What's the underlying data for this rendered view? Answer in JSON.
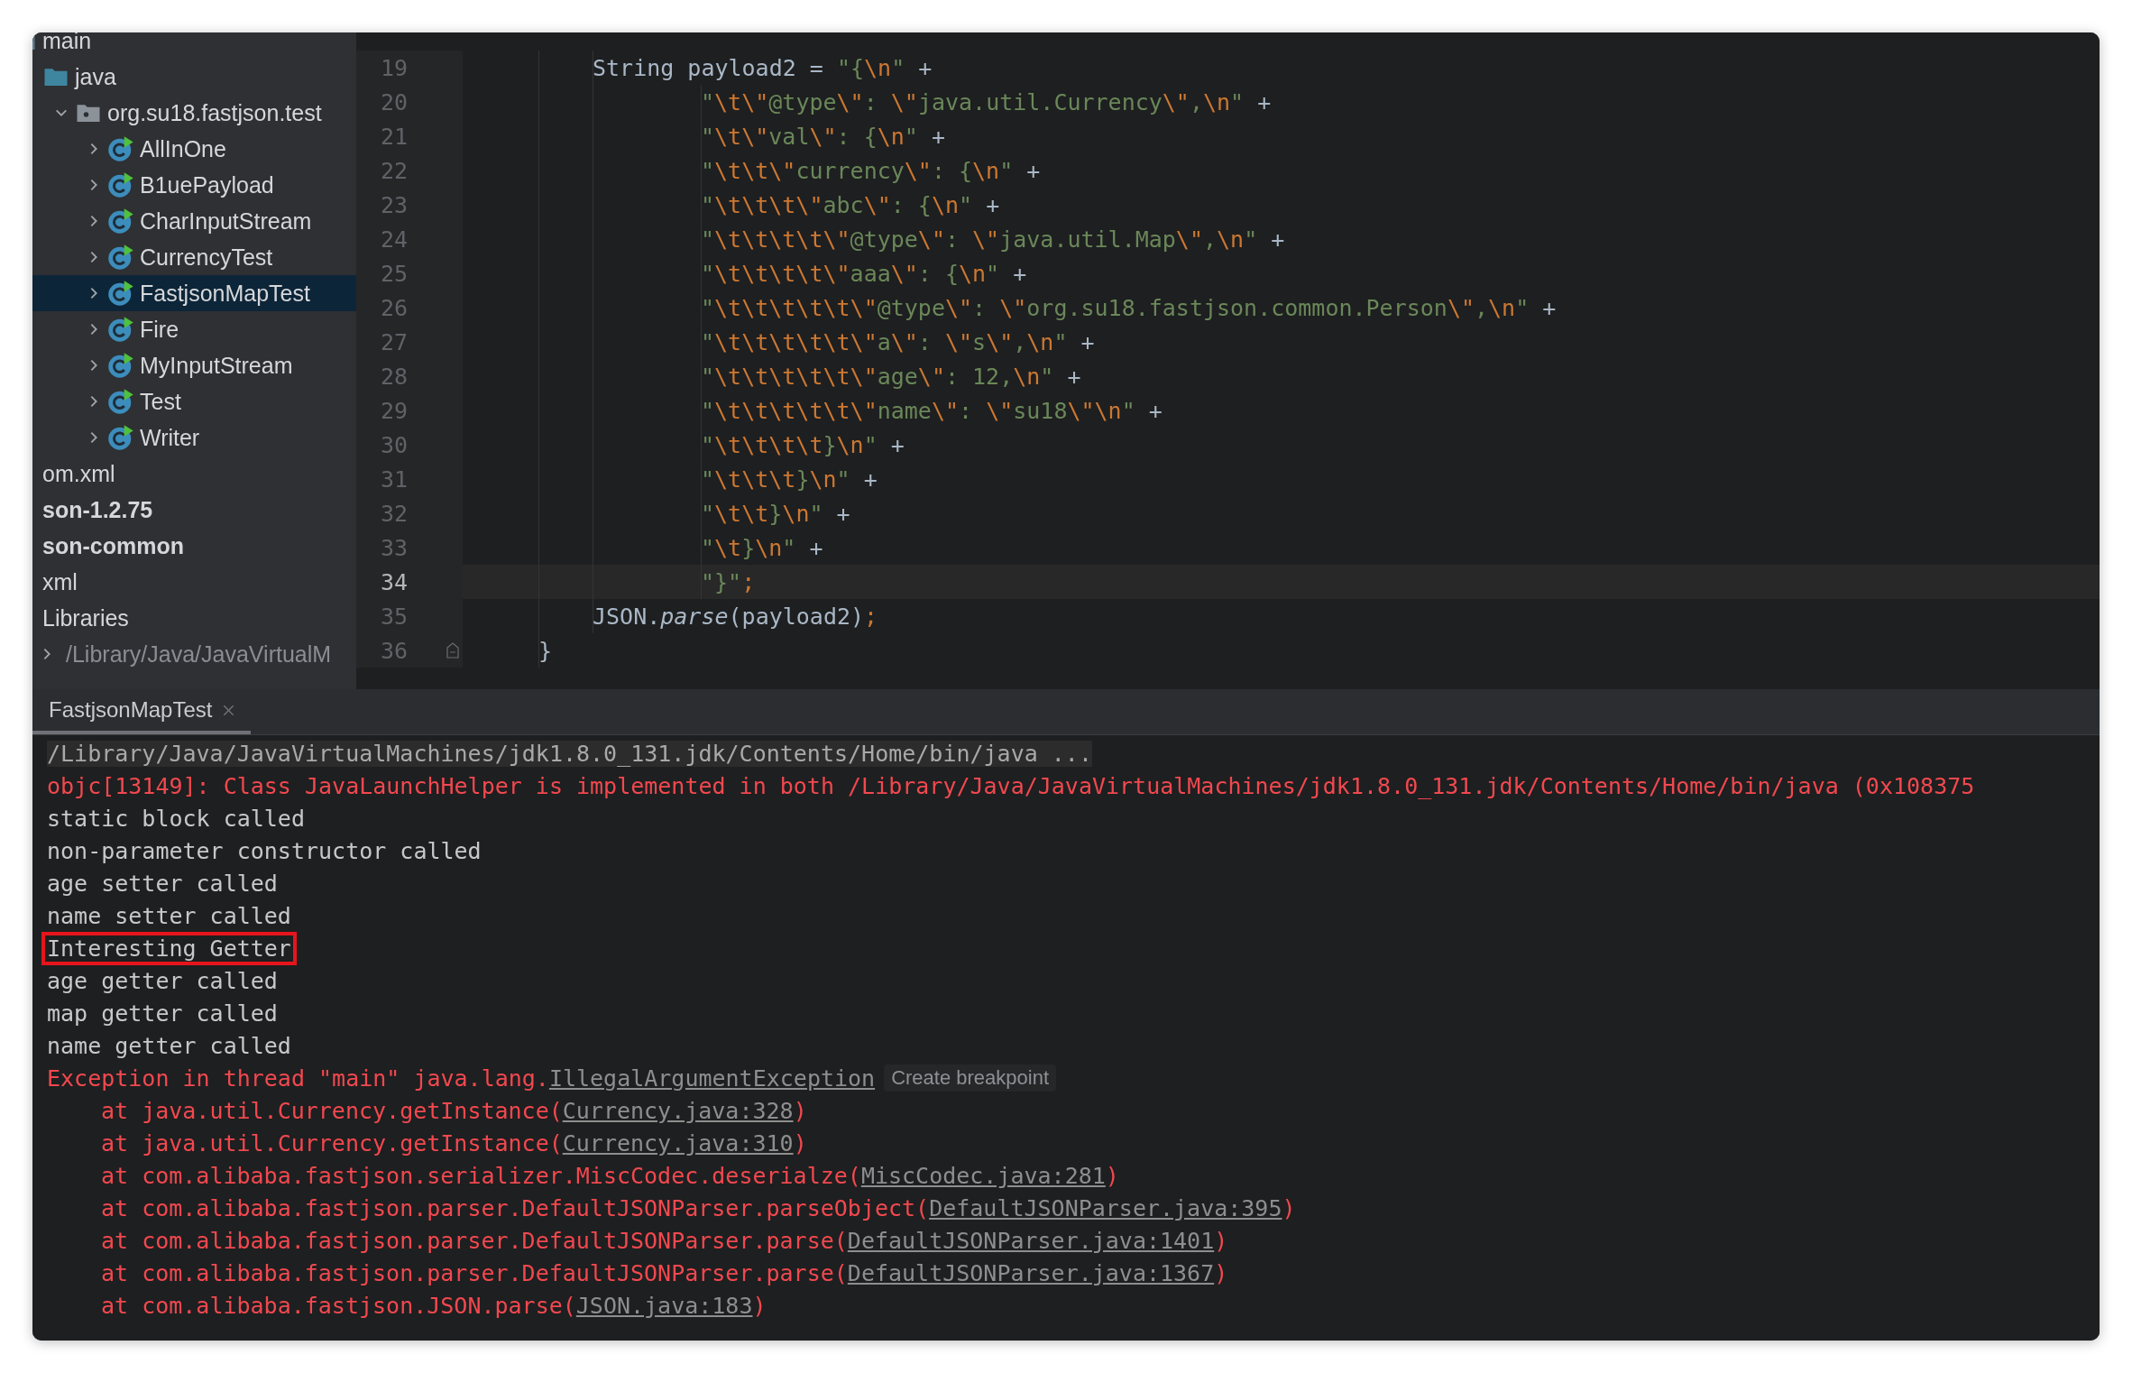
{
  "sidebar": {
    "tree": [
      {
        "label": "main",
        "kind": "folder",
        "selected": false,
        "children": [
          {
            "label": "java",
            "kind": "source-folder",
            "selected": false,
            "children": [
              {
                "label": "org.su18.fastjson.test",
                "kind": "package",
                "expanded": true,
                "selected": false,
                "children": [
                  {
                    "label": "AllInOne",
                    "kind": "class",
                    "expanded": false,
                    "selected": false
                  },
                  {
                    "label": "B1uePayload",
                    "kind": "class",
                    "expanded": false,
                    "selected": false
                  },
                  {
                    "label": "CharInputStream",
                    "kind": "class",
                    "expanded": false,
                    "selected": false
                  },
                  {
                    "label": "CurrencyTest",
                    "kind": "class",
                    "expanded": false,
                    "selected": false
                  },
                  {
                    "label": "FastjsonMapTest",
                    "kind": "class",
                    "expanded": false,
                    "selected": true
                  },
                  {
                    "label": "Fire",
                    "kind": "class",
                    "expanded": false,
                    "selected": false
                  },
                  {
                    "label": "MyInputStream",
                    "kind": "class",
                    "expanded": false,
                    "selected": false
                  },
                  {
                    "label": "Test",
                    "kind": "class",
                    "expanded": false,
                    "selected": false
                  },
                  {
                    "label": "Writer",
                    "kind": "class",
                    "expanded": false,
                    "selected": false
                  }
                ]
              }
            ]
          }
        ]
      },
      {
        "label": "om.xml",
        "kind": "file",
        "selected": false
      },
      {
        "label": "son-1.2.75",
        "kind": "module",
        "selected": false
      },
      {
        "label": "son-common",
        "kind": "module",
        "selected": false
      },
      {
        "label": "xml",
        "kind": "file",
        "selected": false
      },
      {
        "label": "Libraries",
        "kind": "libraries",
        "selected": false,
        "children": [
          {
            "label": "/Library/Java/JavaVirtualM",
            "kind": "sdk",
            "expanded": false,
            "selected": false
          }
        ]
      }
    ]
  },
  "editor": {
    "lines": [
      {
        "number": "19",
        "kind": "statement",
        "current": false,
        "tokens": [
          {
            "kind": "plain",
            "text": "String payload2 = "
          },
          {
            "kind": "str",
            "text": "\"{"
          },
          {
            "kind": "esc",
            "text": "\\n"
          },
          {
            "kind": "str",
            "text": "\""
          },
          {
            "kind": "plain",
            "text": " +"
          }
        ]
      },
      {
        "number": "20",
        "kind": "continuation",
        "current": false,
        "tokens": [
          {
            "kind": "str",
            "text": "\""
          },
          {
            "kind": "esc",
            "text": "\\t\\\""
          },
          {
            "kind": "str",
            "text": "@type"
          },
          {
            "kind": "esc",
            "text": "\\\""
          },
          {
            "kind": "str",
            "text": ": "
          },
          {
            "kind": "esc",
            "text": "\\\""
          },
          {
            "kind": "str",
            "text": "java.util.Currency"
          },
          {
            "kind": "esc",
            "text": "\\\""
          },
          {
            "kind": "str",
            "text": ","
          },
          {
            "kind": "esc",
            "text": "\\n"
          },
          {
            "kind": "str",
            "text": "\""
          },
          {
            "kind": "plain",
            "text": " +"
          }
        ]
      },
      {
        "number": "21",
        "kind": "continuation",
        "current": false,
        "tokens": [
          {
            "kind": "str",
            "text": "\""
          },
          {
            "kind": "esc",
            "text": "\\t\\\""
          },
          {
            "kind": "str",
            "text": "val"
          },
          {
            "kind": "esc",
            "text": "\\\""
          },
          {
            "kind": "str",
            "text": ": {"
          },
          {
            "kind": "esc",
            "text": "\\n"
          },
          {
            "kind": "str",
            "text": "\""
          },
          {
            "kind": "plain",
            "text": " +"
          }
        ]
      },
      {
        "number": "22",
        "kind": "continuation",
        "current": false,
        "tokens": [
          {
            "kind": "str",
            "text": "\""
          },
          {
            "kind": "esc",
            "text": "\\t\\t\\\""
          },
          {
            "kind": "str",
            "text": "currency"
          },
          {
            "kind": "esc",
            "text": "\\\""
          },
          {
            "kind": "str",
            "text": ": {"
          },
          {
            "kind": "esc",
            "text": "\\n"
          },
          {
            "kind": "str",
            "text": "\""
          },
          {
            "kind": "plain",
            "text": " +"
          }
        ]
      },
      {
        "number": "23",
        "kind": "continuation",
        "current": false,
        "tokens": [
          {
            "kind": "str",
            "text": "\""
          },
          {
            "kind": "esc",
            "text": "\\t\\t\\t\\\""
          },
          {
            "kind": "str",
            "text": "abc"
          },
          {
            "kind": "esc",
            "text": "\\\""
          },
          {
            "kind": "str",
            "text": ": {"
          },
          {
            "kind": "esc",
            "text": "\\n"
          },
          {
            "kind": "str",
            "text": "\""
          },
          {
            "kind": "plain",
            "text": " +"
          }
        ]
      },
      {
        "number": "24",
        "kind": "continuation",
        "current": false,
        "tokens": [
          {
            "kind": "str",
            "text": "\""
          },
          {
            "kind": "esc",
            "text": "\\t\\t\\t\\t\\\""
          },
          {
            "kind": "str",
            "text": "@type"
          },
          {
            "kind": "esc",
            "text": "\\\""
          },
          {
            "kind": "str",
            "text": ": "
          },
          {
            "kind": "esc",
            "text": "\\\""
          },
          {
            "kind": "str",
            "text": "java.util.Map"
          },
          {
            "kind": "esc",
            "text": "\\\""
          },
          {
            "kind": "str",
            "text": ","
          },
          {
            "kind": "esc",
            "text": "\\n"
          },
          {
            "kind": "str",
            "text": "\""
          },
          {
            "kind": "plain",
            "text": " +"
          }
        ]
      },
      {
        "number": "25",
        "kind": "continuation",
        "current": false,
        "tokens": [
          {
            "kind": "str",
            "text": "\""
          },
          {
            "kind": "esc",
            "text": "\\t\\t\\t\\t\\\""
          },
          {
            "kind": "str",
            "text": "aaa"
          },
          {
            "kind": "esc",
            "text": "\\\""
          },
          {
            "kind": "str",
            "text": ": {"
          },
          {
            "kind": "esc",
            "text": "\\n"
          },
          {
            "kind": "str",
            "text": "\""
          },
          {
            "kind": "plain",
            "text": " +"
          }
        ]
      },
      {
        "number": "26",
        "kind": "continuation",
        "current": false,
        "tokens": [
          {
            "kind": "str",
            "text": "\""
          },
          {
            "kind": "esc",
            "text": "\\t\\t\\t\\t\\t\\\""
          },
          {
            "kind": "str",
            "text": "@type"
          },
          {
            "kind": "esc",
            "text": "\\\""
          },
          {
            "kind": "str",
            "text": ": "
          },
          {
            "kind": "esc",
            "text": "\\\""
          },
          {
            "kind": "str",
            "text": "org.su18.fastjson.common.Person"
          },
          {
            "kind": "esc",
            "text": "\\\""
          },
          {
            "kind": "str",
            "text": ","
          },
          {
            "kind": "esc",
            "text": "\\n"
          },
          {
            "kind": "str",
            "text": "\""
          },
          {
            "kind": "plain",
            "text": " +"
          }
        ]
      },
      {
        "number": "27",
        "kind": "continuation",
        "current": false,
        "tokens": [
          {
            "kind": "str",
            "text": "\""
          },
          {
            "kind": "esc",
            "text": "\\t\\t\\t\\t\\t\\\""
          },
          {
            "kind": "str",
            "text": "a"
          },
          {
            "kind": "esc",
            "text": "\\\""
          },
          {
            "kind": "str",
            "text": ": "
          },
          {
            "kind": "esc",
            "text": "\\\""
          },
          {
            "kind": "str",
            "text": "s"
          },
          {
            "kind": "esc",
            "text": "\\\""
          },
          {
            "kind": "str",
            "text": ","
          },
          {
            "kind": "esc",
            "text": "\\n"
          },
          {
            "kind": "str",
            "text": "\""
          },
          {
            "kind": "plain",
            "text": " +"
          }
        ]
      },
      {
        "number": "28",
        "kind": "continuation",
        "current": false,
        "tokens": [
          {
            "kind": "str",
            "text": "\""
          },
          {
            "kind": "esc",
            "text": "\\t\\t\\t\\t\\t\\\""
          },
          {
            "kind": "str",
            "text": "age"
          },
          {
            "kind": "esc",
            "text": "\\\""
          },
          {
            "kind": "str",
            "text": ": 12,"
          },
          {
            "kind": "esc",
            "text": "\\n"
          },
          {
            "kind": "str",
            "text": "\""
          },
          {
            "kind": "plain",
            "text": " +"
          }
        ]
      },
      {
        "number": "29",
        "kind": "continuation",
        "current": false,
        "tokens": [
          {
            "kind": "str",
            "text": "\""
          },
          {
            "kind": "esc",
            "text": "\\t\\t\\t\\t\\t\\\""
          },
          {
            "kind": "str",
            "text": "name"
          },
          {
            "kind": "esc",
            "text": "\\\""
          },
          {
            "kind": "str",
            "text": ": "
          },
          {
            "kind": "esc",
            "text": "\\\""
          },
          {
            "kind": "str",
            "text": "su18"
          },
          {
            "kind": "esc",
            "text": "\\\"\\n"
          },
          {
            "kind": "str",
            "text": "\""
          },
          {
            "kind": "plain",
            "text": " +"
          }
        ]
      },
      {
        "number": "30",
        "kind": "continuation",
        "current": false,
        "tokens": [
          {
            "kind": "str",
            "text": "\""
          },
          {
            "kind": "esc",
            "text": "\\t\\t\\t\\t"
          },
          {
            "kind": "str",
            "text": "}"
          },
          {
            "kind": "esc",
            "text": "\\n"
          },
          {
            "kind": "str",
            "text": "\""
          },
          {
            "kind": "plain",
            "text": " +"
          }
        ]
      },
      {
        "number": "31",
        "kind": "continuation",
        "current": false,
        "tokens": [
          {
            "kind": "str",
            "text": "\""
          },
          {
            "kind": "esc",
            "text": "\\t\\t\\t"
          },
          {
            "kind": "str",
            "text": "}"
          },
          {
            "kind": "esc",
            "text": "\\n"
          },
          {
            "kind": "str",
            "text": "\""
          },
          {
            "kind": "plain",
            "text": " +"
          }
        ]
      },
      {
        "number": "32",
        "kind": "continuation",
        "current": false,
        "tokens": [
          {
            "kind": "str",
            "text": "\""
          },
          {
            "kind": "esc",
            "text": "\\t\\t"
          },
          {
            "kind": "str",
            "text": "}"
          },
          {
            "kind": "esc",
            "text": "\\n"
          },
          {
            "kind": "str",
            "text": "\""
          },
          {
            "kind": "plain",
            "text": " +"
          }
        ]
      },
      {
        "number": "33",
        "kind": "continuation",
        "current": false,
        "tokens": [
          {
            "kind": "str",
            "text": "\""
          },
          {
            "kind": "esc",
            "text": "\\t"
          },
          {
            "kind": "str",
            "text": "}"
          },
          {
            "kind": "esc",
            "text": "\\n"
          },
          {
            "kind": "str",
            "text": "\""
          },
          {
            "kind": "plain",
            "text": " +"
          }
        ]
      },
      {
        "number": "34",
        "kind": "continuation",
        "current": true,
        "tokens": [
          {
            "kind": "str",
            "text": "\"}\""
          },
          {
            "kind": "punct",
            "text": ";"
          }
        ]
      },
      {
        "number": "35",
        "kind": "statement",
        "current": false,
        "tokens": [
          {
            "kind": "plain",
            "text": "JSON."
          },
          {
            "kind": "method",
            "text": "parse"
          },
          {
            "kind": "plain",
            "text": "(payload2)"
          },
          {
            "kind": "punct",
            "text": ";"
          }
        ]
      },
      {
        "number": "36",
        "kind": "block-end",
        "current": false,
        "fold": true,
        "tokens": [
          {
            "kind": "plain",
            "text": "}"
          }
        ]
      }
    ]
  },
  "console": {
    "tab": {
      "label": "FastjsonMapTest",
      "selected": true
    },
    "lines": [
      {
        "kind": "command",
        "text": "/Library/Java/JavaVirtualMachines/jdk1.8.0_131.jdk/Contents/Home/bin/java ...",
        "highlighted": false
      },
      {
        "kind": "error",
        "text": "objc[13149]: Class JavaLaunchHelper is implemented in both /Library/Java/JavaVirtualMachines/jdk1.8.0_131.jdk/Contents/Home/bin/java (0x108375",
        "highlighted": false
      },
      {
        "kind": "output",
        "text": "static block called",
        "highlighted": false
      },
      {
        "kind": "output",
        "text": "non-parameter constructor called",
        "highlighted": false
      },
      {
        "kind": "output",
        "text": "age setter called",
        "highlighted": false
      },
      {
        "kind": "output",
        "text": "name setter called",
        "highlighted": false
      },
      {
        "kind": "output",
        "text": "Interesting Getter",
        "highlighted": true
      },
      {
        "kind": "output",
        "text": "age getter called",
        "highlighted": false
      },
      {
        "kind": "output",
        "text": "map getter called",
        "highlighted": false
      },
      {
        "kind": "output",
        "text": "name getter called",
        "highlighted": false
      },
      {
        "kind": "exception",
        "text": "Exception in thread \"main\" java.lang.",
        "link": "IllegalArgumentException",
        "hint": "Create breakpoint",
        "highlighted": false
      },
      {
        "kind": "trace",
        "text": "at java.util.Currency.getInstance(",
        "link": "Currency.java:328",
        "tail": ")",
        "highlighted": false
      },
      {
        "kind": "trace",
        "text": "at java.util.Currency.getInstance(",
        "link": "Currency.java:310",
        "tail": ")",
        "highlighted": false
      },
      {
        "kind": "trace",
        "text": "at com.alibaba.fastjson.serializer.MiscCodec.deserialze(",
        "link": "MiscCodec.java:281",
        "tail": ")",
        "highlighted": false
      },
      {
        "kind": "trace",
        "text": "at com.alibaba.fastjson.parser.DefaultJSONParser.parseObject(",
        "link": "DefaultJSONParser.java:395",
        "tail": ")",
        "highlighted": false
      },
      {
        "kind": "trace",
        "text": "at com.alibaba.fastjson.parser.DefaultJSONParser.parse(",
        "link": "DefaultJSONParser.java:1401",
        "tail": ")",
        "highlighted": false
      },
      {
        "kind": "trace",
        "text": "at com.alibaba.fastjson.parser.DefaultJSONParser.parse(",
        "link": "DefaultJSONParser.java:1367",
        "tail": ")",
        "highlighted": false
      },
      {
        "kind": "trace",
        "text": "at com.alibaba.fastjson.JSON.parse(",
        "link": "JSON.java:183",
        "tail": ")",
        "highlighted": false
      }
    ]
  }
}
